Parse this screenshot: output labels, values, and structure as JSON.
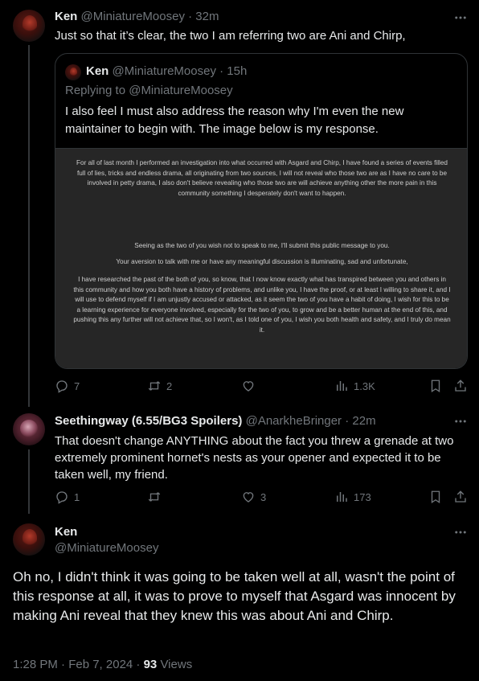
{
  "posts": [
    {
      "name": "Ken",
      "handle": "@MiniatureMoosey",
      "time": "· 32m",
      "text": "Just so that it’s clear, the two I am referring two are Ani and Chirp,",
      "quote": {
        "name": "Ken",
        "handle": "@MiniatureMoosey",
        "time": "· 15h",
        "replying_to": "Replying to @MiniatureMoosey",
        "text": "I also feel I must also address the reason why I'm even the new maintainer to begin with. The image below is my response.",
        "image_paragraphs": [
          "For all of last month I performed an investigation into what occurred with Asgard and Chirp, I have found a series of events filled full of lies, tricks and endless drama, all originating from two sources, I will not reveal who those two are as I have no care to be involved in petty drama, I also don't believe revealing who those two are will achieve anything other the more pain in this community something I desperately don't want to happen.",
          "Seeing as the two of you wish not to speak to me, I'll submit this public message to you.",
          "Your aversion to talk with me or have any meaningful discussion is illuminating, sad and unfortunate,",
          "I have researched the past of the both of you, so know, that I now know exactly what has transpired between you and others in this community and how you both have a history of problems, and unlike you, I have the proof, or at least I willing to share it, and I will use to defend myself if I am unjustly accused or attacked, as it seem the two of you have a habit of doing, I wish for this to be a learning experience for everyone involved, especially for the two of you, to grow and be a better human at the end of this, and pushing this any further will not achieve that, so I won't, as I told one of you, I wish you both health and safety, and I truly do mean it."
        ]
      },
      "stats": {
        "replies": "7",
        "reposts": "2",
        "likes": "",
        "views": "1.3K"
      }
    },
    {
      "name": "Seethingway (6.55/BG3 Spoilers)",
      "handle": "@AnarkheBringer",
      "time": "· 22m",
      "text": "That doesn't change ANYTHING about the fact you threw a grenade at two extremely prominent hornet's nests as your opener and expected it to be taken well, my friend.",
      "stats": {
        "replies": "1",
        "reposts": "",
        "likes": "3",
        "views": "173"
      }
    },
    {
      "name": "Ken",
      "handle": "@MiniatureMoosey",
      "text": "Oh no, I didn't think it was going to be taken well at all, wasn't the point of this response at all, it was to prove to myself that Asgard was innocent by making Ani reveal that they knew this was about Ani and Chirp.",
      "timestamp": "1:28 PM · Feb 7, 2024 ·",
      "views_count": "93",
      "views_label": "Views"
    }
  ],
  "colors": {
    "background": "#000000",
    "text": "#e7e9ea",
    "muted": "#71767b",
    "border": "#2f3336"
  },
  "icons": [
    "more-icon",
    "reply-icon",
    "repost-icon",
    "like-icon",
    "views-icon",
    "bookmark-icon",
    "share-icon"
  ]
}
